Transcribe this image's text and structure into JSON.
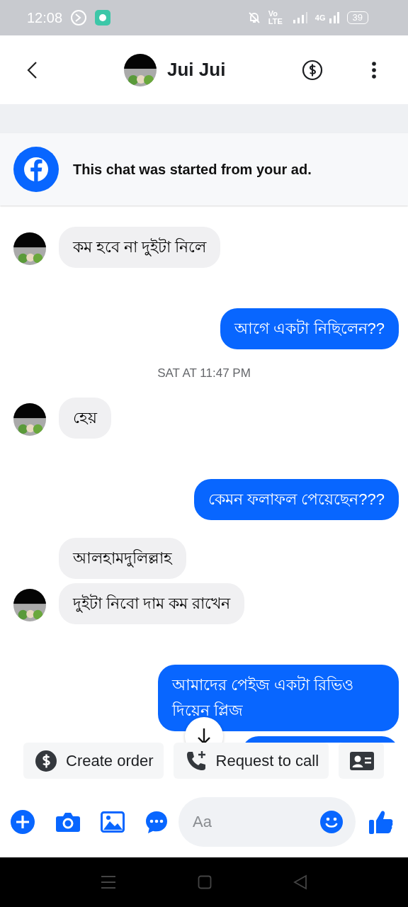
{
  "status_bar": {
    "time": "12:08",
    "volte": "Vo LTE",
    "network": "4G",
    "battery": "39"
  },
  "header": {
    "name": "Jui Jui"
  },
  "ad_banner": {
    "text": "This chat was started from your ad."
  },
  "messages": [
    {
      "kind": "incoming",
      "avatar": true,
      "text": "কম হবে না দুইটা নিলে"
    },
    {
      "kind": "outgoing",
      "text": "আগে একটা নিছিলেন??"
    },
    {
      "kind": "timestamp",
      "text": "SAT AT 11:47 PM"
    },
    {
      "kind": "incoming",
      "avatar": true,
      "text": "হেয়"
    },
    {
      "kind": "outgoing",
      "text": "কেমন ফলাফল পেয়েছেন???"
    },
    {
      "kind": "incoming",
      "avatar": false,
      "text": "আলহামদুলিল্লাহ"
    },
    {
      "kind": "incoming",
      "avatar": true,
      "text": "দুইটা নিবো দাম কম রাখেন"
    },
    {
      "kind": "outgoing",
      "text": "আমাদের পেইজ একটা রিভিও দিয়েন প্লিজ"
    },
    {
      "kind": "cut_off"
    }
  ],
  "quick_actions": [
    {
      "kind": "order",
      "label": "Create order"
    },
    {
      "kind": "call",
      "label": "Request to call"
    },
    {
      "kind": "contact"
    }
  ],
  "composer": {
    "placeholder": "Aa"
  }
}
